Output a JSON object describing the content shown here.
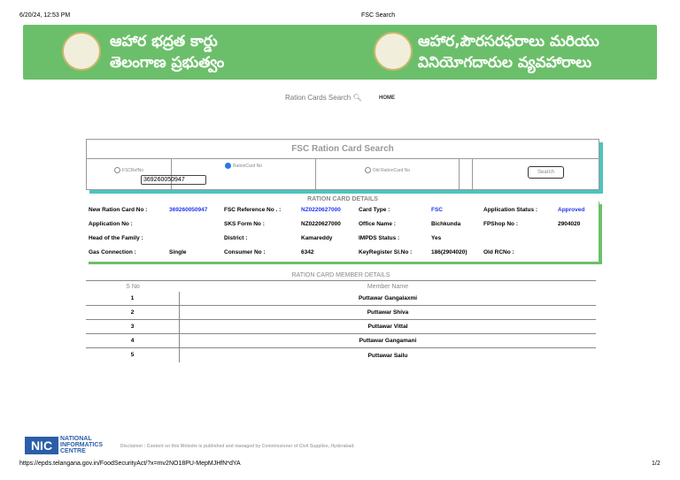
{
  "header": {
    "datetime": "6/20/24, 12:53 PM",
    "page_title": "FSC Search"
  },
  "banner": {
    "left_line1": "ఆహార భద్రత కార్డు",
    "left_line2": "తెలంగాణ ప్రభుత్వం",
    "right_line1": "ఆహార,పౌరసరఫరాలు మరియు",
    "right_line2": "వినియోగదారుల వ్యవహారాలు"
  },
  "nav": {
    "search_link": "Ration Cards Search",
    "home_link": "HOME"
  },
  "search": {
    "title": "FSC Ration Card Search",
    "options": [
      "FSCRefNo",
      "RationCard No",
      "Old RationCard No"
    ],
    "selected": "RationCard No",
    "input_value": "369260050947",
    "button": "Search"
  },
  "details": {
    "title": "RATION CARD DETAILS",
    "fields": [
      {
        "label": "New Ration Card No :",
        "value": "369260050947"
      },
      {
        "label": "FSC Reference No . :",
        "value": "NZ0220627000"
      },
      {
        "label": "Card Type :",
        "value": "FSC"
      },
      {
        "label": "Application Status :",
        "value": "Approved"
      },
      {
        "label": "Application No :",
        "value": ""
      },
      {
        "label": "SKS Form No :",
        "value": "NZ0220627000"
      },
      {
        "label": "Office Name :",
        "value": "Bichkunda"
      },
      {
        "label": "FPShop No :",
        "value": "2904020"
      },
      {
        "label": "Head of the Family :",
        "value": ""
      },
      {
        "label": "District :",
        "value": "Kamareddy"
      },
      {
        "label": "IMPDS Status :",
        "value": "Yes"
      },
      {
        "label": "",
        "value": ""
      },
      {
        "label": "Gas Connection :",
        "value": "Single"
      },
      {
        "label": "Consumer No :",
        "value": "6342"
      },
      {
        "label": "KeyRegister Sl.No :",
        "value": "186(2904020)"
      },
      {
        "label": "Old RCNo :",
        "value": ""
      }
    ]
  },
  "members": {
    "title": "RATION CARD MEMBER DETAILS",
    "columns": [
      "S No",
      "Member Name"
    ],
    "rows": [
      {
        "sno": "1",
        "name": "Puttawar Gangalaxmi"
      },
      {
        "sno": "2",
        "name": "Puttawar Shiva"
      },
      {
        "sno": "3",
        "name": "Puttawar Vittal"
      },
      {
        "sno": "4",
        "name": "Puttawar Gangamani"
      },
      {
        "sno": "5",
        "name": "Puttawar Sailu"
      }
    ]
  },
  "footer": {
    "logo_line1": "NATIONAL",
    "logo_line2": "INFORMATICS",
    "logo_line3": "CENTRE",
    "disclaimer": "Disclaimer : Content on this Website is published and managed by Commissioner of Civil Supplies, Hyderabad.",
    "url": "https://epds.telangana.gov.in/FoodSecurityAct/?x=mv2NO18PU-MepMJHfN*dYA",
    "page": "1/2"
  }
}
